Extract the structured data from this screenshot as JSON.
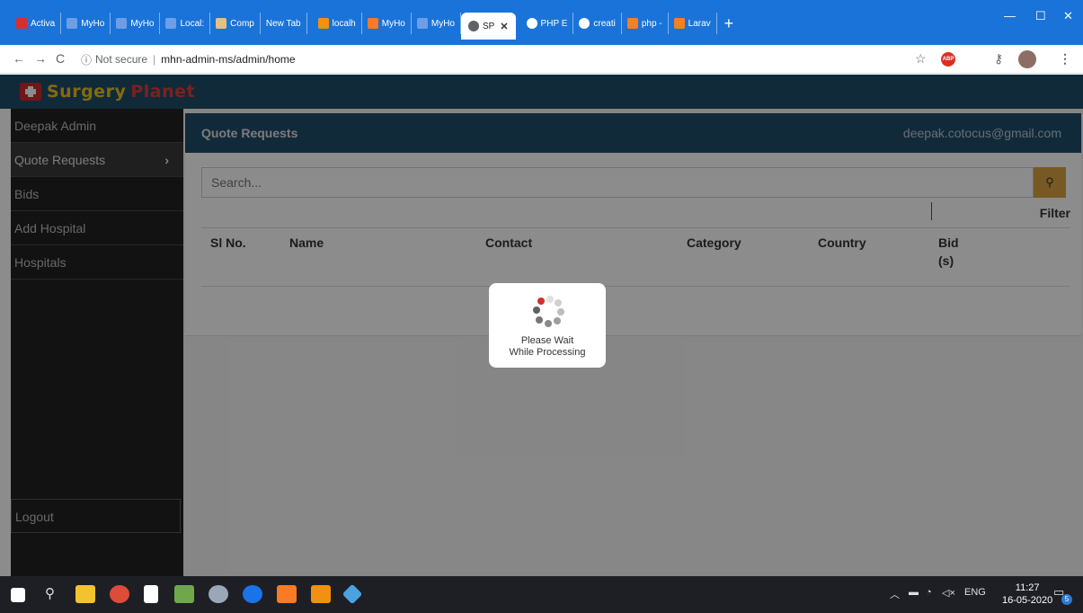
{
  "browser": {
    "tabs": [
      {
        "label": "Activa",
        "icon": "gmail-icon",
        "color": "#d93025"
      },
      {
        "label": "MyHo",
        "icon": "site-icon",
        "color": "#f0f0f0"
      },
      {
        "label": "MyHo",
        "icon": "site-icon",
        "color": "#f0f0f0"
      },
      {
        "label": "Local:",
        "icon": "site-icon",
        "color": "#f0f0f0"
      },
      {
        "label": "Comp",
        "icon": "composer-icon",
        "color": "#e8c07a"
      },
      {
        "label": "New Tab",
        "icon": "",
        "color": ""
      },
      {
        "label": "localh",
        "icon": "phpmyadmin-icon",
        "color": "#f29111"
      },
      {
        "label": "MyHo",
        "icon": "xampp-icon",
        "color": "#fb7a24"
      },
      {
        "label": "MyHo",
        "icon": "site-icon",
        "color": "#f0f0f0"
      }
    ],
    "active_tab": {
      "label": "SP",
      "icon": "globe-icon"
    },
    "tabs_after": [
      {
        "label": "PHP E",
        "icon": "google-icon",
        "color": "#ffffff"
      },
      {
        "label": "creati",
        "icon": "google-icon",
        "color": "#ffffff"
      },
      {
        "label": "php -",
        "icon": "stackoverflow-icon",
        "color": "#f48024"
      },
      {
        "label": "Larav",
        "icon": "stackoverflow-icon",
        "color": "#f48024"
      }
    ],
    "new_tab_symbol": "+",
    "close_symbol": "✕",
    "window_controls": {
      "minimize": "—",
      "maximize": "☐",
      "close": "✕"
    },
    "security_label": "Not secure",
    "url": "mhn-admin-ms/admin/home"
  },
  "app": {
    "logo": {
      "word1": "Surgery",
      "word2": "Planet"
    }
  },
  "sidebar": {
    "items": [
      {
        "label": "Deepak Admin"
      },
      {
        "label": "Quote Requests",
        "active": true
      },
      {
        "label": "Bids"
      },
      {
        "label": "Add Hospital"
      },
      {
        "label": "Hospitals"
      }
    ],
    "logout_label": "Logout"
  },
  "main": {
    "title": "Quote Requests",
    "user_email": "deepak.cotocus@gmail.com",
    "search_placeholder": "Search...",
    "filter_label": "Filter",
    "columns": [
      "Sl No.",
      "Name",
      "Contact",
      "Category",
      "Country",
      "Bid (s)"
    ]
  },
  "loader": {
    "line1": "Please Wait",
    "line2": "While Processing"
  },
  "taskbar": {
    "language": "ENG",
    "time": "11:27",
    "date": "16-05-2020",
    "notifications": "5"
  },
  "colors": {
    "header": "#1f4e6b",
    "sidebar": "#222222",
    "accent": "#d9a441",
    "logo_yellow": "#f3c01c",
    "logo_red": "#e23b36"
  }
}
